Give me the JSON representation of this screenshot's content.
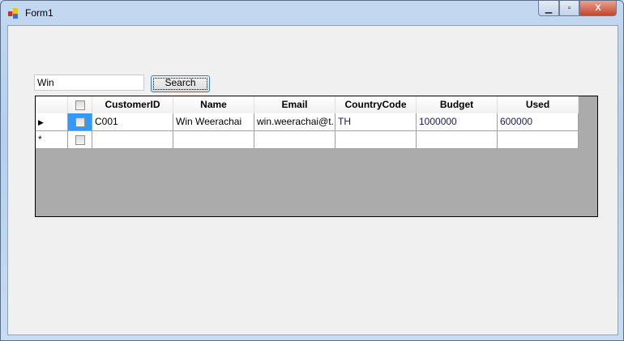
{
  "window": {
    "title": "Form1"
  },
  "search": {
    "value": "Win",
    "button": "Search"
  },
  "grid": {
    "headers": [
      "CustomerID",
      "Name",
      "Email",
      "CountryCode",
      "Budget",
      "Used"
    ],
    "rows": [
      [
        "C001",
        "Win Weerachai",
        "win.weerachai@t...",
        "TH",
        "1000000",
        "600000"
      ]
    ],
    "new_row_marker": "*",
    "current_row_marker": "▶"
  }
}
